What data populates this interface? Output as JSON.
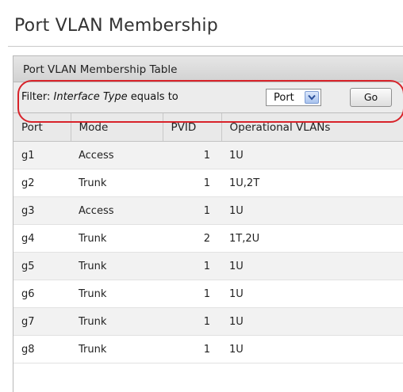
{
  "page": {
    "title": "Port VLAN Membership"
  },
  "table": {
    "caption": "Port VLAN Membership Table",
    "filter": {
      "label_prefix": "Filter:",
      "label_field": "Interface Type",
      "label_op": "equals to",
      "select_value": "Port",
      "go_label": "Go"
    },
    "columns": [
      "Port",
      "Mode",
      "PVID",
      "Operational VLANs"
    ],
    "rows": [
      {
        "port": "g1",
        "mode": "Access",
        "pvid": "1",
        "vlans": "1U"
      },
      {
        "port": "g2",
        "mode": "Trunk",
        "pvid": "1",
        "vlans": "1U,2T"
      },
      {
        "port": "g3",
        "mode": "Access",
        "pvid": "1",
        "vlans": "1U"
      },
      {
        "port": "g4",
        "mode": "Trunk",
        "pvid": "2",
        "vlans": "1T,2U"
      },
      {
        "port": "g5",
        "mode": "Trunk",
        "pvid": "1",
        "vlans": "1U"
      },
      {
        "port": "g6",
        "mode": "Trunk",
        "pvid": "1",
        "vlans": "1U"
      },
      {
        "port": "g7",
        "mode": "Trunk",
        "pvid": "1",
        "vlans": "1U"
      },
      {
        "port": "g8",
        "mode": "Trunk",
        "pvid": "1",
        "vlans": "1U"
      }
    ]
  },
  "colors": {
    "highlight": "#d8232a",
    "header_bg": "#e9e9e9",
    "row_alt": "#f2f2f2"
  },
  "icons": {
    "select_arrow": "chevron-down-icon"
  }
}
